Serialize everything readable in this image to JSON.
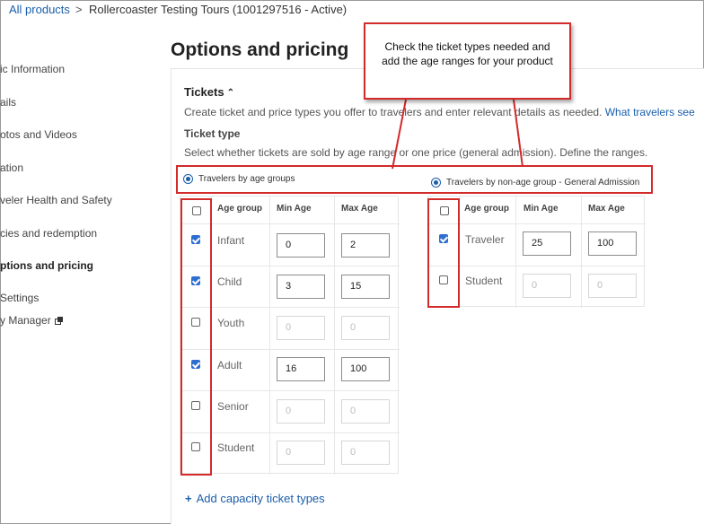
{
  "breadcrumb": {
    "all_products": "All products",
    "separator": ">",
    "current": "Rollercoaster Testing Tours (1001297516 - Active)"
  },
  "sidebar": {
    "items": [
      {
        "label": "ic Information"
      },
      {
        "label": "ails"
      },
      {
        "label": "otos and Videos"
      },
      {
        "label": "ation"
      },
      {
        "label": "veler Health and Safety"
      },
      {
        "label": "cies and redemption"
      },
      {
        "label": "ptions and pricing",
        "active": true
      },
      {
        "label": "Settings"
      },
      {
        "label": "y Manager",
        "icon": "external-link-icon"
      }
    ]
  },
  "page": {
    "title": "Options and pricing"
  },
  "tickets": {
    "title": "Tickets",
    "desc_part1": "Create ticket and price types you offer to travelers and enter relevant details as needed.",
    "link_text": "What travelers see",
    "ticket_type_title": "Ticket type",
    "ticket_type_desc": "Select whether tickets are sold by age range or one price (general admission). Define the ranges.",
    "radio_age": "Travelers by age groups",
    "radio_non_age": "Travelers by non-age group - General Admission"
  },
  "age_table": {
    "headers": {
      "group": "Age group",
      "min": "Min Age",
      "max": "Max Age"
    },
    "rows": [
      {
        "label": "Infant",
        "checked": true,
        "min": "0",
        "max": "2",
        "enabled": true
      },
      {
        "label": "Child",
        "checked": true,
        "min": "3",
        "max": "15",
        "enabled": true
      },
      {
        "label": "Youth",
        "checked": false,
        "min": "0",
        "max": "0",
        "enabled": false
      },
      {
        "label": "Adult",
        "checked": true,
        "min": "16",
        "max": "100",
        "enabled": true
      },
      {
        "label": "Senior",
        "checked": false,
        "min": "0",
        "max": "0",
        "enabled": false
      },
      {
        "label": "Student",
        "checked": false,
        "min": "0",
        "max": "0",
        "enabled": false
      }
    ]
  },
  "non_age_table": {
    "headers": {
      "group": "Age group",
      "min": "Min Age",
      "max": "Max Age"
    },
    "rows": [
      {
        "label": "Traveler",
        "checked": true,
        "min": "25",
        "max": "100",
        "enabled": true
      },
      {
        "label": "Student",
        "checked": false,
        "min": "0",
        "max": "0",
        "enabled": false
      }
    ]
  },
  "add_capacity": {
    "icon": "+",
    "label": "Add capacity ticket types"
  },
  "callout": {
    "text": "Check the ticket types needed and add the age ranges for your product"
  },
  "colors": {
    "link": "#1a5eab",
    "checkbox": "#2f6ed1",
    "annotation": "#d32a2a"
  }
}
